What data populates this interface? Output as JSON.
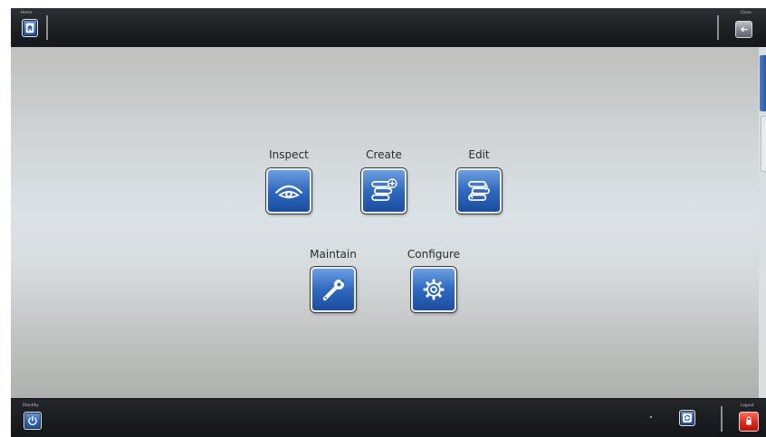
{
  "topbar": {
    "home_label": "Home",
    "close_label": "Close",
    "home_icon": "home-icon",
    "close_icon": "back-arrow-icon"
  },
  "menu": {
    "tiles": [
      {
        "label": "Inspect",
        "icon": "eye-icon"
      },
      {
        "label": "Create",
        "icon": "scroll-add-icon"
      },
      {
        "label": "Edit",
        "icon": "scroll-icon"
      },
      {
        "label": "Maintain",
        "icon": "wrench-icon"
      },
      {
        "label": "Configure",
        "icon": "gear-icon"
      }
    ]
  },
  "bottombar": {
    "standby_label": "Standby",
    "logout_label": "Logout",
    "standby_icon": "power-icon",
    "sync_icon": "refresh-icon",
    "logout_icon": "logout-icon"
  },
  "colors": {
    "accent_blue": "#2f69c0",
    "logout_red": "#e3251b",
    "bar_dark": "#1d2023"
  }
}
